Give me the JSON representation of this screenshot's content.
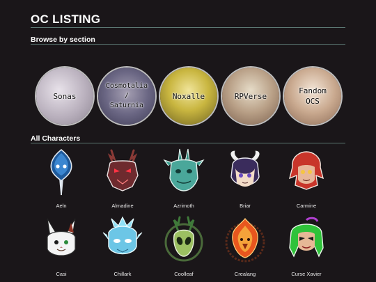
{
  "page": {
    "title": "OC LISTING"
  },
  "sections_heading": "Browse by section",
  "sections": [
    {
      "label": "Sonas"
    },
    {
      "label": "Cosmotalia\n/\nSaturnia"
    },
    {
      "label": "Noxalle"
    },
    {
      "label": "RPVerse"
    },
    {
      "label": "Fandom\nOCS"
    }
  ],
  "characters_heading": "All Characters",
  "characters": [
    {
      "name": "Aeln",
      "icon": "blue-drop-mask-icon"
    },
    {
      "name": "Almadine",
      "icon": "red-antler-creature-icon"
    },
    {
      "name": "Azrimoth",
      "icon": "teal-horned-creature-icon"
    },
    {
      "name": "Briar",
      "icon": "horned-purple-hair-character-icon"
    },
    {
      "name": "Carmine",
      "icon": "red-haired-character-icon"
    },
    {
      "name": "Casi",
      "icon": "white-rabbit-creature-icon"
    },
    {
      "name": "Chillark",
      "icon": "ice-blue-creature-icon"
    },
    {
      "name": "Coolleaf",
      "icon": "green-antler-alien-icon"
    },
    {
      "name": "Crealang",
      "icon": "flame-bird-icon"
    },
    {
      "name": "Curse Xavier",
      "icon": "green-haired-character-icon"
    }
  ]
}
